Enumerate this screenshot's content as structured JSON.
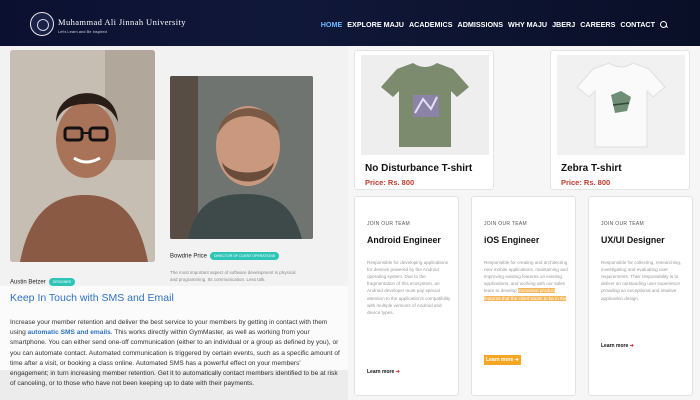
{
  "header": {
    "brand": "Muhammad Ali Jinnah University",
    "brand_sub": "Let's Learn and Be Inspired",
    "nav": [
      "HOME",
      "EXPLORE MAJU",
      "ACADEMICS",
      "ADMISSIONS",
      "WHY MAJU",
      "JBERJ",
      "CAREERS",
      "CONTACT"
    ],
    "active_color": "#6bb8ff"
  },
  "people": [
    {
      "name": "Austin Betzer",
      "badge": "DESIGNER"
    },
    {
      "name": "Bowdrie Price",
      "badge": "DIRECTOR OF CLIENT OPERATIONS",
      "bio": "The most important aspect of software development is physical and programming. Its communication. Less talk."
    }
  ],
  "sms": {
    "title": "Keep In Touch with SMS and Email",
    "text_before": "Increase your member retention and deliver the best service to your members by getting in contact with them using ",
    "link": "automatic SMS and emails",
    "text_after": ". This works directly within GymMaster, as well as working from your smartphone. You can either send one-off communication (either to an individual or a group as defined by you), or you can automate contact. Automated communication is triggered by certain events, such as a specific amount of time after a visit, or booking a class online. Automated SMS has a powerful effect on your members' engagement; in turn increasing member retention. Get it to automatically contact members identified to be at risk of canceling, or to those who have not been keeping up to date with their payments."
  },
  "products": [
    {
      "name": "No Disturbance T-shirt",
      "price": "Price: Rs. 800",
      "color": "#7c8a6e"
    },
    {
      "name": "Zebra T-shirt",
      "price": "Price: Rs. 800",
      "color": "#f0f0f0"
    }
  ],
  "jobs": [
    {
      "kicker": "JOIN OUR TEAM",
      "title": "Android Engineer",
      "desc": "Responsible for developing applications for devices powered by the Android operating system. Due to the fragmentation of this ecosystem, an Android developer must pay special attention to the application's compatibility with multiple versions of Android and device types.",
      "learn": "Learn more"
    },
    {
      "kicker": "JOIN OUR TEAM",
      "title": "iOS Engineer",
      "desc_before": "Responsible for creating and architecting new mobile applications, maintaining and improving existing features on existing applications, and working with our sales team to develop ",
      "desc_hl": "innovative product features that the client wants to be in the",
      "learn": "Learn more"
    },
    {
      "kicker": "JOIN OUR TEAM",
      "title": "UX/UI Designer",
      "desc": "Responsible for collecting, researching, investigating and evaluating user requirements. Their responsibility is to deliver an outstanding user experience providing an exceptional and intuitive application design.",
      "learn": "Learn more"
    }
  ]
}
